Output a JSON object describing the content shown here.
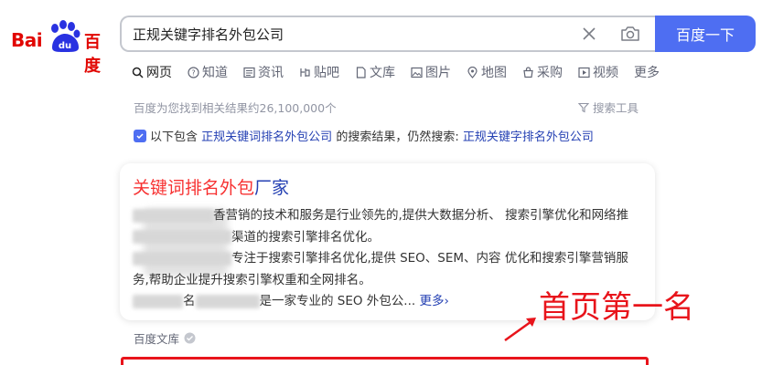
{
  "logo": {
    "left": "Bai",
    "middle": "du",
    "right": "百度"
  },
  "search": {
    "query": "正规关键字排名外包公司",
    "button_label": "百度一下"
  },
  "tabs": [
    {
      "label": "网页",
      "icon": "search-icon"
    },
    {
      "label": "知道",
      "icon": "question-icon"
    },
    {
      "label": "资讯",
      "icon": "news-icon"
    },
    {
      "label": "贴吧",
      "icon": "tieba-icon"
    },
    {
      "label": "文库",
      "icon": "document-icon"
    },
    {
      "label": "图片",
      "icon": "image-icon"
    },
    {
      "label": "地图",
      "icon": "map-pin-icon"
    },
    {
      "label": "采购",
      "icon": "purchase-icon"
    },
    {
      "label": "视频",
      "icon": "video-icon"
    },
    {
      "label": "更多",
      "icon": ""
    }
  ],
  "result_count": "百度为您找到相关结果约26,100,000个",
  "search_tools": "搜索工具",
  "hint": {
    "prefix": "以下包含",
    "keyword": "正规关键词排名外包公司",
    "middle": "的搜索结果，仍然搜索:",
    "original": "正规关键字排名外包公司"
  },
  "result": {
    "title_highlight": "关键词排名外包",
    "title_rest": "厂家",
    "line1": "香营销的技术和服务是行业领先的,提供大数据分析、 搜索引擎优化和网络推",
    "line2": "渠道的搜索引擎排名优化。",
    "line3": "专注于搜索引擎排名优化,提供 SEO、SEM、内容 优化和搜索引擎营销服",
    "line4": "务,帮助企业提升搜索引擎权重和全网排名。",
    "line5_a": "名",
    "line5_b": "是一家专业的 SEO 外包公...",
    "more": "更多",
    "source": "百度文库"
  },
  "annotation": "首页第一名",
  "colors": {
    "accent": "#4e6ef2",
    "brand_red": "#e10602",
    "link": "#2440b3",
    "highlight": "#f73131",
    "annotation": "#e8141b"
  }
}
